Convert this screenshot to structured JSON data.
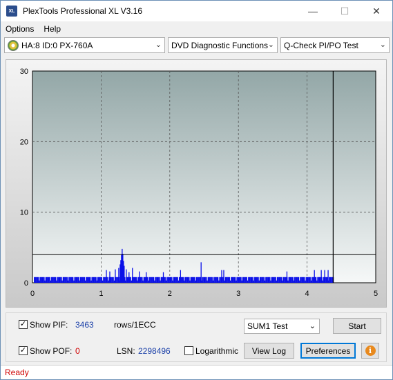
{
  "window": {
    "title": "PlexTools Professional XL V3.16",
    "icon_label": "XL",
    "controls": {
      "minimize": "—",
      "maximize": "☐",
      "close": "✕"
    }
  },
  "menu": [
    {
      "label": "Options"
    },
    {
      "label": "Help"
    }
  ],
  "toolbar": {
    "drive": "HA:8 ID:0  PX-760A",
    "function": "DVD Diagnostic Functions",
    "test": "Q-Check PI/PO Test",
    "chevron": "⌄"
  },
  "chart_data": {
    "type": "bar",
    "xlim": [
      0,
      5
    ],
    "ylim": [
      0,
      30
    ],
    "x_ticks": [
      "0",
      "1",
      "2",
      "3",
      "4",
      "5"
    ],
    "y_ticks": [
      "0",
      "10",
      "20",
      "30"
    ],
    "grid": true,
    "threshold_line": 4,
    "end_marker_x": 4.38,
    "baseline_value": 0.8,
    "spikes": [
      {
        "x": 1.07,
        "y": 1.8
      },
      {
        "x": 1.12,
        "y": 1.6
      },
      {
        "x": 1.2,
        "y": 1.9
      },
      {
        "x": 1.25,
        "y": 2.1
      },
      {
        "x": 1.27,
        "y": 2.6
      },
      {
        "x": 1.28,
        "y": 3.2
      },
      {
        "x": 1.29,
        "y": 4.0
      },
      {
        "x": 1.3,
        "y": 4.8
      },
      {
        "x": 1.31,
        "y": 4.1
      },
      {
        "x": 1.32,
        "y": 3.1
      },
      {
        "x": 1.33,
        "y": 2.4
      },
      {
        "x": 1.36,
        "y": 1.9
      },
      {
        "x": 1.4,
        "y": 1.5
      },
      {
        "x": 1.45,
        "y": 2.1
      },
      {
        "x": 1.55,
        "y": 1.6
      },
      {
        "x": 1.65,
        "y": 1.5
      },
      {
        "x": 1.9,
        "y": 1.5
      },
      {
        "x": 2.15,
        "y": 1.8
      },
      {
        "x": 2.45,
        "y": 2.9
      },
      {
        "x": 2.75,
        "y": 1.8
      },
      {
        "x": 2.78,
        "y": 1.8
      },
      {
        "x": 3.7,
        "y": 1.6
      },
      {
        "x": 4.1,
        "y": 1.8
      },
      {
        "x": 4.2,
        "y": 1.8
      },
      {
        "x": 4.25,
        "y": 1.8
      },
      {
        "x": 4.3,
        "y": 1.8
      }
    ]
  },
  "controls": {
    "show_pif_label": "Show PIF:",
    "show_pif_checked": "✓",
    "pif_value": "3463",
    "rows_unit": "rows/1ECC",
    "show_pof_label": "Show POF:",
    "show_pof_checked": "✓",
    "pof_value": "0",
    "lsn_label": "LSN:",
    "lsn_value": "2298496",
    "logarithmic_label": "Logarithmic",
    "sum_test_value": "SUM1 Test",
    "start_label": "Start",
    "view_log_label": "View Log",
    "preferences_label": "Preferences",
    "info_glyph": "i"
  },
  "status": {
    "text": "Ready",
    "text_color": "#d00000"
  },
  "colors": {
    "bar_blue": "#0a10e8",
    "plot_top": "#93a7a7",
    "plot_bottom": "#f6f8f8"
  }
}
